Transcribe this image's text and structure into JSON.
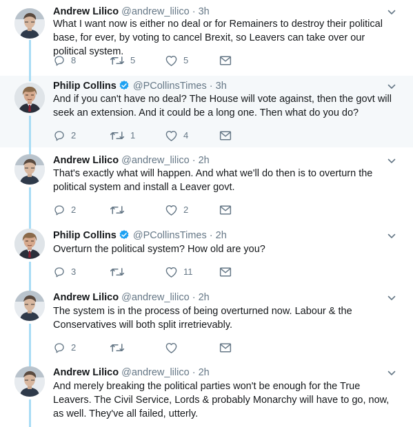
{
  "colors": {
    "accent": "#1da1f2",
    "thread_line": "#a8dcf5",
    "highlight_bg": "#f5f8fa",
    "muted": "#657786"
  },
  "icons": {
    "reply": "reply-icon",
    "retweet": "retweet-icon",
    "like": "heart-icon",
    "dm": "envelope-icon",
    "menu": "chevron-down-icon",
    "verified": "verified-badge-icon"
  },
  "tweets": [
    {
      "name": "Andrew Lilico",
      "handle": "@andrew_lilico",
      "dot": "·",
      "time": "3h",
      "verified": false,
      "text": "What I want now is either no deal or for Remainers to destroy their political base, for ever, by voting to cancel Brexit, so Leavers can take over our political system.",
      "replies": "8",
      "retweets": "5",
      "likes": "5"
    },
    {
      "name": "Philip Collins",
      "handle": "@PCollinsTimes",
      "dot": "·",
      "time": "3h",
      "verified": true,
      "text": "And if you can't have no deal? The House will vote against, then the govt will seek an extension. And it could be a long one. Then what do you do?",
      "replies": "2",
      "retweets": "1",
      "likes": "4"
    },
    {
      "name": "Andrew Lilico",
      "handle": "@andrew_lilico",
      "dot": "·",
      "time": "2h",
      "verified": false,
      "text": "That's exactly what will happen. And what we'll do then is to overturn the political system and install a Leaver govt.",
      "replies": "2",
      "retweets": "",
      "likes": "2"
    },
    {
      "name": "Philip Collins",
      "handle": "@PCollinsTimes",
      "dot": "·",
      "time": "2h",
      "verified": true,
      "text": "Overturn the political system? How old are you?",
      "replies": "3",
      "retweets": "",
      "likes": "11"
    },
    {
      "name": "Andrew Lilico",
      "handle": "@andrew_lilico",
      "dot": "·",
      "time": "2h",
      "verified": false,
      "text": "The system is in the process of being overturned now. Labour & the Conservatives will both split irretrievably.",
      "replies": "2",
      "retweets": "",
      "likes": ""
    },
    {
      "name": "Andrew Lilico",
      "handle": "@andrew_lilico",
      "dot": "·",
      "time": "2h",
      "verified": false,
      "text": "And merely breaking the political parties won't be enough for the True Leavers. The Civil Service, Lords & probably Monarchy will have to go, now, as well. They've all failed, utterly.",
      "replies": "",
      "retweets": "",
      "likes": ""
    }
  ]
}
